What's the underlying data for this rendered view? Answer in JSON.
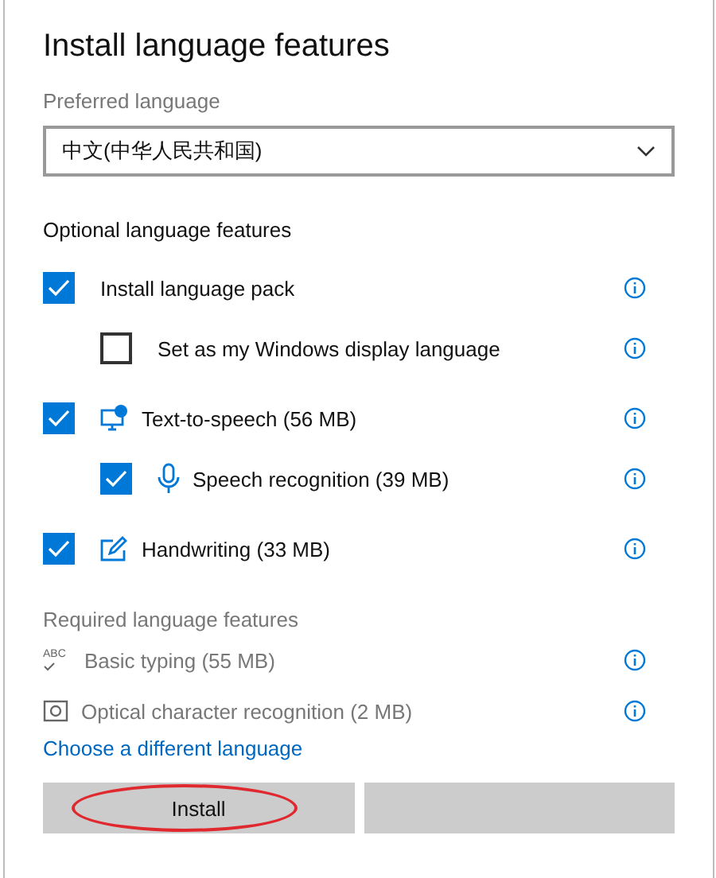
{
  "dialog": {
    "title": "Install language features"
  },
  "preferred_language": {
    "label": "Preferred language",
    "value": "中文(中华人民共和国)"
  },
  "optional_features": {
    "heading": "Optional language features",
    "items": [
      {
        "label": "Install language pack",
        "kind": "plain",
        "checked": true,
        "children": [
          {
            "label": "Set as my Windows display language",
            "kind": "plain",
            "checked": false
          }
        ]
      },
      {
        "label": "Text-to-speech (56 MB)",
        "kind": "speech",
        "checked": true,
        "children": [
          {
            "label": "Speech recognition (39 MB)",
            "kind": "microphone",
            "checked": true
          }
        ]
      },
      {
        "label": "Handwriting (33 MB)",
        "kind": "handwriting",
        "checked": true
      }
    ]
  },
  "required_features": {
    "heading": "Required language features",
    "items": [
      {
        "label": "Basic typing (55 MB)",
        "kind": "typing",
        "icon_text": "ABC"
      },
      {
        "label": "Optical character recognition (2 MB)",
        "kind": "ocr"
      }
    ]
  },
  "link": "Choose a different language",
  "buttons": [
    {
      "label": "Install",
      "circled": true
    },
    {
      "circled": false
    }
  ]
}
